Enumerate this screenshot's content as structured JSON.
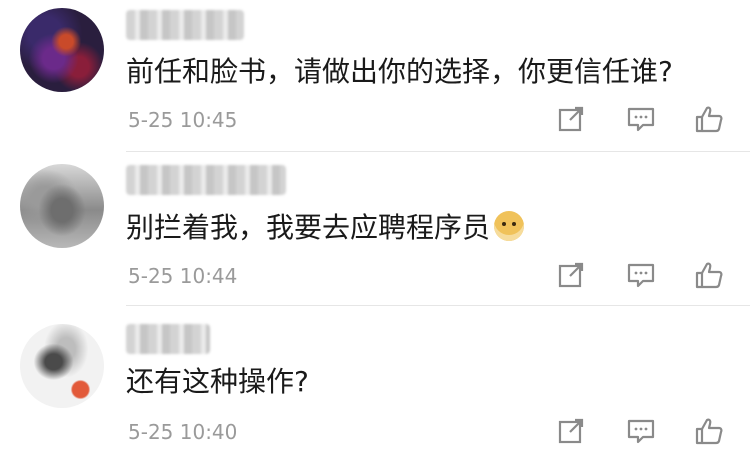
{
  "comments": [
    {
      "text": "前任和脸书，请做出你的选择，你更信任谁?",
      "time": "5-25 10:45",
      "has_emoji": false
    },
    {
      "text": "别拦着我，我要去应聘程序员",
      "time": "5-25 10:44",
      "has_emoji": true,
      "emoji_icon": "doge-emoji-icon"
    },
    {
      "text": "还有这种操作?",
      "time": "5-25 10:40",
      "has_emoji": false
    }
  ],
  "actions": {
    "share_icon": "share-icon",
    "reply_icon": "reply-icon",
    "like_icon": "like-icon"
  },
  "colors": {
    "text": "#1a1a1a",
    "meta": "#9a9a9a",
    "icon": "#8a8a8a",
    "divider": "#e6e6e6"
  }
}
